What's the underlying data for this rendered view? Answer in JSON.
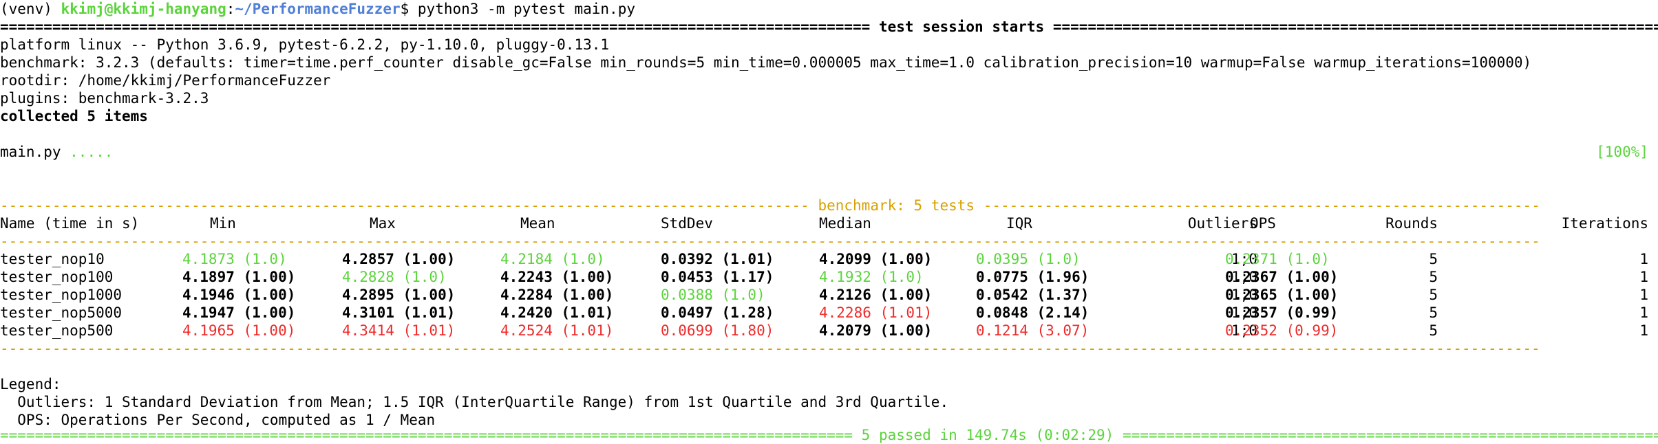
{
  "prompt": {
    "venv": "(venv)",
    "user_host": "kkimj@kkimj-hanyang",
    "colon": ":",
    "path": "~/PerformanceFuzzer",
    "dollar": "$",
    "command": " python3 -m pytest main.py"
  },
  "session": {
    "header": " test session starts ",
    "platform": "platform linux -- Python 3.6.9, pytest-6.2.2, py-1.10.0, pluggy-0.13.1",
    "benchmark": "benchmark: 3.2.3 (defaults: timer=time.perf_counter disable_gc=False min_rounds=5 min_time=0.000005 max_time=1.0 calibration_precision=10 warmup=False warmup_iterations=100000)",
    "rootdir": "rootdir: /home/kkimj/PerformanceFuzzer",
    "plugins": "plugins: benchmark-3.2.3",
    "collected": "collected 5 items",
    "file": "main.py",
    "dots": " .....",
    "percent": "[100%]"
  },
  "benchmark_table": {
    "title": " benchmark: 5 tests ",
    "columns": [
      "Name (time in s)",
      "Min",
      "Max",
      "Mean",
      "StdDev",
      "Median",
      "IQR",
      "Outliers",
      "OPS",
      "Rounds",
      "Iterations"
    ],
    "rows": [
      {
        "name": "tester_nop10",
        "min": "4.1873 (1.0)",
        "max": "4.2857 (1.00)",
        "mean": "4.2184 (1.0)",
        "stddev": "0.0392 (1.01)",
        "median": "4.2099 (1.00)",
        "iqr": "0.0395 (1.0)",
        "outliers": "1;0",
        "ops": "0.2371 (1.0)",
        "rounds": "5",
        "iterations": "1"
      },
      {
        "name": "tester_nop100",
        "min": "4.1897 (1.00)",
        "max": "4.2828 (1.0)",
        "mean": "4.2243 (1.00)",
        "stddev": "0.0453 (1.17)",
        "median": "4.1932 (1.0)",
        "iqr": "0.0775 (1.96)",
        "outliers": "1;0",
        "ops": "0.2367 (1.00)",
        "rounds": "5",
        "iterations": "1"
      },
      {
        "name": "tester_nop1000",
        "min": "4.1946 (1.00)",
        "max": "4.2895 (1.00)",
        "mean": "4.2284 (1.00)",
        "stddev": "0.0388 (1.0)",
        "median": "4.2126 (1.00)",
        "iqr": "0.0542 (1.37)",
        "outliers": "1;0",
        "ops": "0.2365 (1.00)",
        "rounds": "5",
        "iterations": "1"
      },
      {
        "name": "tester_nop5000",
        "min": "4.1947 (1.00)",
        "max": "4.3101 (1.01)",
        "mean": "4.2420 (1.01)",
        "stddev": "0.0497 (1.28)",
        "median": "4.2286 (1.01)",
        "iqr": "0.0848 (2.14)",
        "outliers": "1;0",
        "ops": "0.2357 (0.99)",
        "rounds": "5",
        "iterations": "1"
      },
      {
        "name": "tester_nop500",
        "min": "4.1965 (1.00)",
        "max": "4.3414 (1.01)",
        "mean": "4.2524 (1.01)",
        "stddev": "0.0699 (1.80)",
        "median": "4.2079 (1.00)",
        "iqr": "0.1214 (3.07)",
        "outliers": "1;0",
        "ops": "0.2352 (0.99)",
        "rounds": "5",
        "iterations": "1"
      }
    ]
  },
  "legend": {
    "title": "Legend:",
    "outliers": "  Outliers: 1 Standard Deviation from Mean; 1.5 IQR (InterQuartile Range) from 1st Quartile and 3rd Quartile.",
    "ops": "  OPS: Operations Per Second, computed as 1 / Mean"
  },
  "footer": {
    "summary": " 5 passed in 149.74s (0:02:29) "
  },
  "colors": {
    "best": "#5bd43c",
    "worst": "#ee2a2a",
    "path": "#4f7fd6",
    "benchmark_title": "#d8a000"
  }
}
